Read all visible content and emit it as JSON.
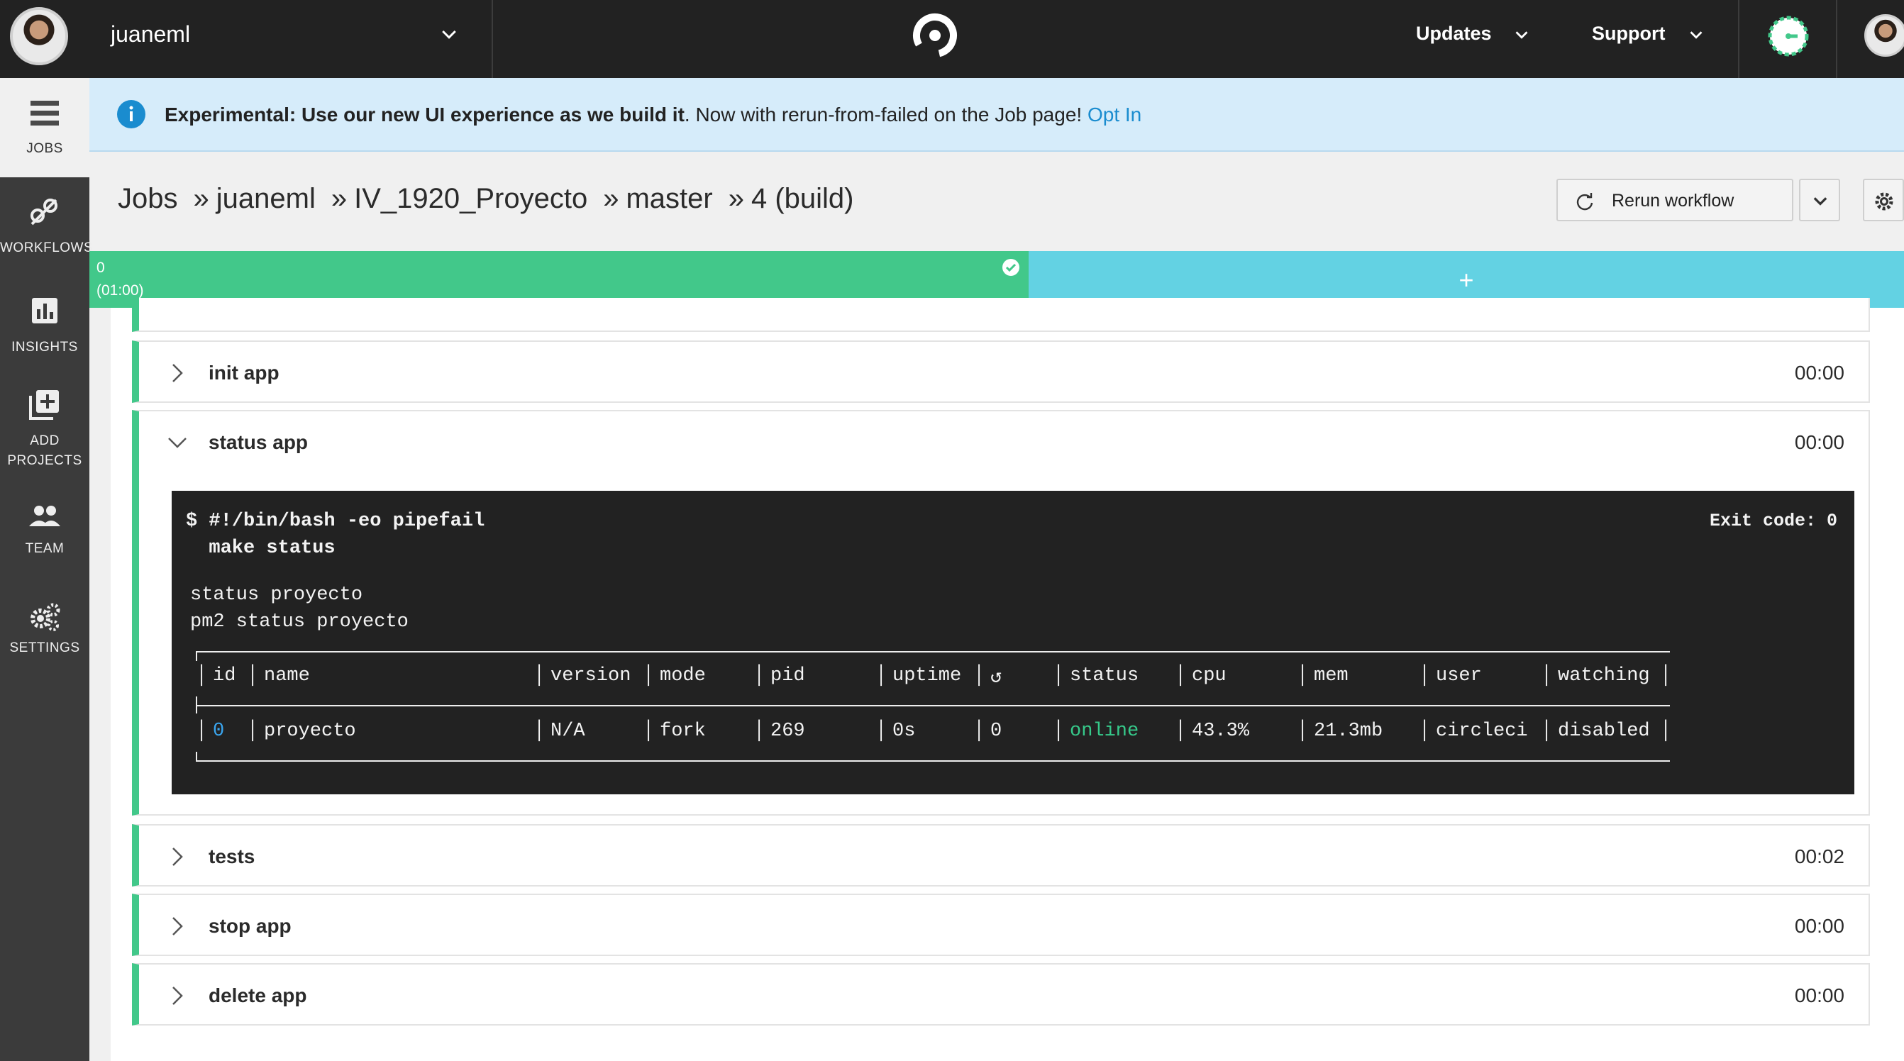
{
  "topbar": {
    "org_name": "juaneml",
    "nav": [
      {
        "label": "Updates",
        "icon": "chevron-down-icon"
      },
      {
        "label": "Support",
        "icon": "chevron-down-icon"
      }
    ],
    "logo_icon": "circleci-logo-icon",
    "status_icon": "clock-icon"
  },
  "sidebar": {
    "items": [
      {
        "label": "JOBS",
        "icon": "jobs-list-icon",
        "active": true
      },
      {
        "label": "WORKFLOWS",
        "icon": "workflows-icon",
        "active": false
      },
      {
        "label": "INSIGHTS",
        "icon": "insights-chart-icon",
        "active": false
      },
      {
        "label": "ADD",
        "label2": "PROJECTS",
        "icon": "add-project-icon",
        "active": false
      },
      {
        "label": "TEAM",
        "icon": "team-icon",
        "active": false
      },
      {
        "label": "SETTINGS",
        "icon": "gears-icon",
        "active": false
      }
    ]
  },
  "banner": {
    "bold": "Experimental: Use our new UI experience as we build it",
    "text": ". Now with rerun-from-failed on the Job page! ",
    "link": "Opt In"
  },
  "breadcrumb": [
    "Jobs",
    "juaneml",
    "IV_1920_Proyecto",
    "master",
    "4 (build)"
  ],
  "breadcrumb_sep": "»",
  "actions": {
    "rerun_label": "Rerun workflow"
  },
  "parallel": {
    "index": "0",
    "duration": "(01:00)",
    "add_label": "+"
  },
  "steps": [
    {
      "name": "init app",
      "time": "00:00",
      "expanded": false
    },
    {
      "name": "status app",
      "time": "00:00",
      "expanded": true
    },
    {
      "name": "tests",
      "time": "00:02",
      "expanded": false
    },
    {
      "name": "stop app",
      "time": "00:00",
      "expanded": false
    },
    {
      "name": "delete app",
      "time": "00:00",
      "expanded": false
    }
  ],
  "terminal": {
    "cmd1": "$ #!/bin/bash -eo pipefail",
    "cmd2": "  make status",
    "exit": "Exit code: 0",
    "out1": "status proyecto",
    "out2": "pm2 status proyecto",
    "pm2_headers": [
      "id",
      "name",
      "version",
      "mode",
      "pid",
      "uptime",
      "↺",
      "status",
      "cpu",
      "mem",
      "user",
      "watching"
    ],
    "pm2_row": [
      "0",
      "proyecto",
      "N/A",
      "fork",
      "269",
      "0s",
      "0",
      "online",
      "43.3%",
      "21.3mb",
      "circleci",
      "disabled"
    ]
  },
  "colors": {
    "success": "#42c88a",
    "parallel_add": "#63d2e3",
    "banner_bg": "#d6ecfa",
    "link": "#1a8ccf"
  }
}
